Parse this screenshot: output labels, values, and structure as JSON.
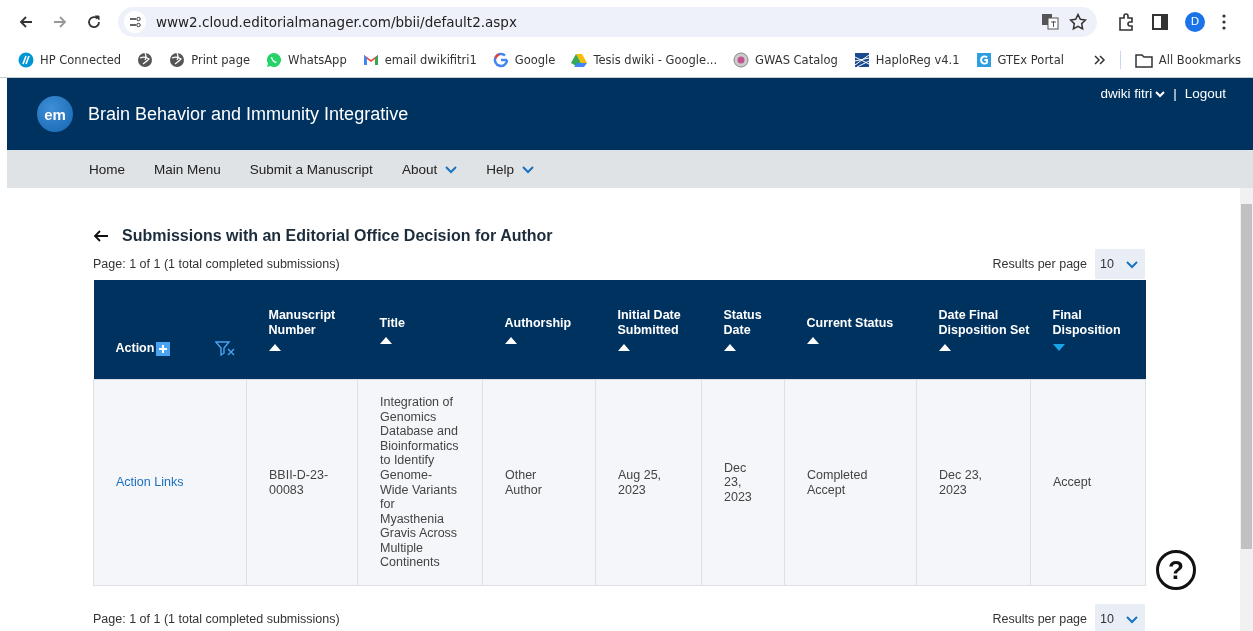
{
  "browser": {
    "url": "www2.cloud.editorialmanager.com/bbii/default2.aspx",
    "profile": "D",
    "bookmarks": [
      {
        "kind": "labelled",
        "label": "HP Connected"
      },
      {
        "kind": "icon"
      },
      {
        "kind": "labelled",
        "label": "Print page"
      },
      {
        "kind": "labelled",
        "label": "WhatsApp"
      },
      {
        "kind": "labelled",
        "label": "email dwikifitri1"
      },
      {
        "kind": "labelled",
        "label": "Google"
      },
      {
        "kind": "labelled",
        "label": "Tesis dwiki - Google..."
      },
      {
        "kind": "labelled",
        "label": "GWAS Catalog"
      },
      {
        "kind": "labelled",
        "label": "HaploReg v4.1"
      },
      {
        "kind": "labelled",
        "label": "GTEx Portal"
      }
    ],
    "all_bookmarks": "All Bookmarks"
  },
  "journal": {
    "logo": "em",
    "title": "Brain Behavior and Immunity Integrative",
    "user": "dwiki fitri",
    "separator": "|",
    "logout": "Logout"
  },
  "nav": [
    {
      "label": "Home",
      "dropdown": false
    },
    {
      "label": "Main Menu",
      "dropdown": false
    },
    {
      "label": "Submit a Manuscript",
      "dropdown": false
    },
    {
      "label": "About",
      "dropdown": true
    },
    {
      "label": "Help",
      "dropdown": true
    }
  ],
  "page": {
    "title": "Submissions with an Editorial Office Decision for Author",
    "summary": "Page: 1 of 1 (1 total completed submissions)",
    "results_label": "Results per page",
    "results_value": "10"
  },
  "table": {
    "columns": [
      {
        "kind": "action",
        "label": "Action"
      },
      {
        "kind": "sortable",
        "label": "Manuscript Number",
        "sorted": false
      },
      {
        "kind": "sortable",
        "label": "Title",
        "sorted": false
      },
      {
        "kind": "sortable",
        "label": "Authorship",
        "sorted": false
      },
      {
        "kind": "sortable",
        "label": "Initial Date Submitted",
        "sorted": false
      },
      {
        "kind": "sortable",
        "label": "Status Date",
        "sorted": false
      },
      {
        "kind": "sortable",
        "label": "Current Status",
        "sorted": false
      },
      {
        "kind": "sortable",
        "label": "Date Final Disposition Set",
        "sorted": false
      },
      {
        "kind": "sortable",
        "label": "Final Disposition",
        "sorted": true
      }
    ],
    "rows": [
      {
        "cells": [
          "Action Links",
          "BBII-D-23-00083",
          "Integration of Genomics Database and Bioinformatics to Identify Genome-Wide Variants for Myasthenia Gravis Across Multiple Continents",
          "Other Author",
          "Aug 25, 2023",
          "Dec 23, 2023",
          "Completed Accept",
          "Dec 23, 2023",
          "Accept"
        ]
      }
    ]
  },
  "footer": {
    "summary": "Page: 1 of 1 (1 total completed submissions)",
    "results_label": "Results per page",
    "results_value": "10"
  },
  "help_button": "?"
}
